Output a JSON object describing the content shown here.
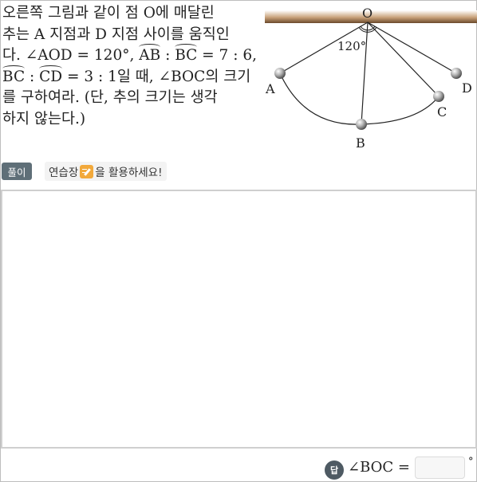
{
  "problem": {
    "line1": "오른쪽 그림과 같이 점 O에 매달린",
    "line2": "추는 A 지점과 D 지점 사이를 움직인",
    "line3_a": "다. ∠AOD = 120°, ",
    "arc_ab": "AB",
    "colon1": " : ",
    "arc_bc": "BC",
    "line3_b": " = 7 : 6,",
    "line4_arc_bc": "BC",
    "line4_a": " : ",
    "arc_cd": "CD",
    "line4_b": " = 3 : 1일 때, ∠BOC의 크기",
    "line5": "를 구하여라. (단, 추의 크기는 생각",
    "line6": "하지 않는다.)"
  },
  "figure": {
    "label_o": "O",
    "label_a": "A",
    "label_b": "B",
    "label_c": "C",
    "label_d": "D",
    "angle_label": "120°"
  },
  "solve_button": "풀이",
  "hint": {
    "before": "연습장",
    "after": "을 활용하세요!",
    "icon": "pencil-note-icon"
  },
  "answer": {
    "badge": "답",
    "label": "∠BOC =",
    "value": "",
    "unit": "°"
  }
}
